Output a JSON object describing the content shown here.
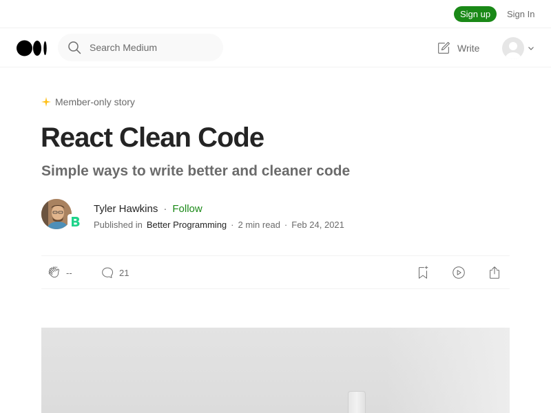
{
  "topbar": {
    "signup_label": "Sign up",
    "signin_label": "Sign In"
  },
  "nav": {
    "search_placeholder": "Search Medium",
    "write_label": "Write"
  },
  "article": {
    "member_badge": "Member-only story",
    "title": "React Clean Code",
    "subtitle": "Simple ways to write better and cleaner code",
    "author_name": "Tyler Hawkins",
    "separator": "·",
    "follow_label": "Follow",
    "published_in_label": "Published in",
    "publication": "Better Programming",
    "read_time": "2 min read",
    "date": "Feb 24, 2021"
  },
  "actions": {
    "claps": "--",
    "responses": "21"
  },
  "colors": {
    "accent_green": "#1a8917",
    "member_star": "#ffc017",
    "text_primary": "#242424",
    "text_secondary": "#6b6b6b"
  }
}
